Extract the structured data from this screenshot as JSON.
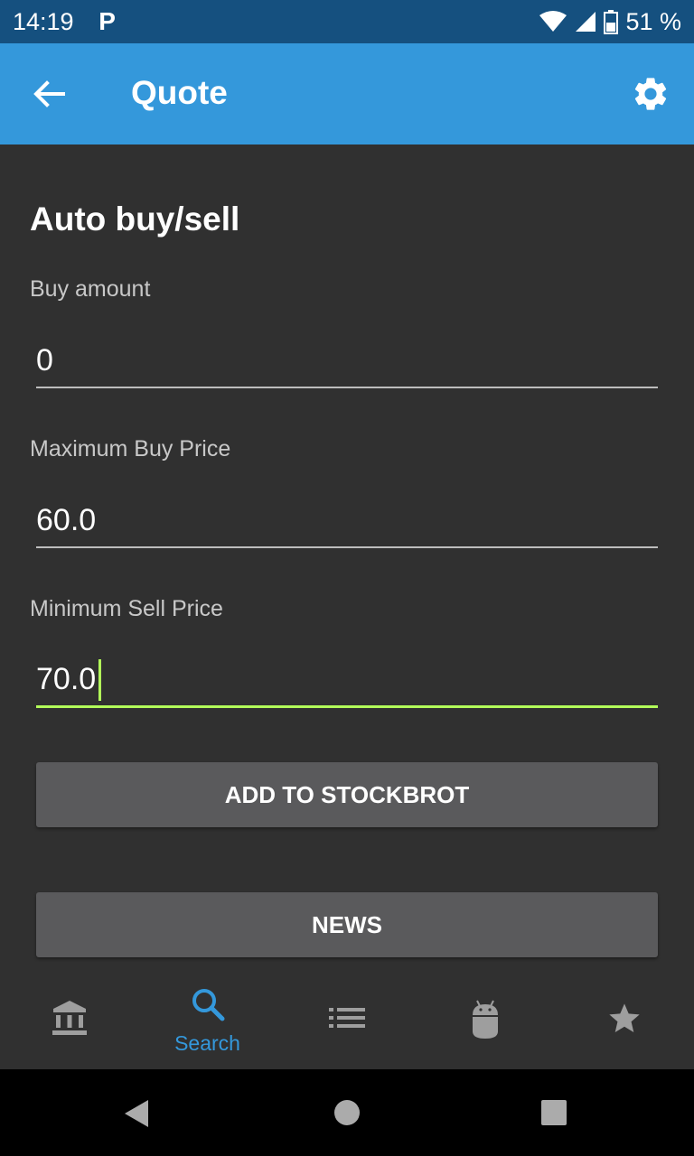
{
  "status_bar": {
    "time": "14:19",
    "notification": "P",
    "battery": "51 %"
  },
  "app_bar": {
    "title": "Quote",
    "back_icon": "arrow-back-icon",
    "settings_icon": "gear-icon"
  },
  "form": {
    "title": "Auto buy/sell",
    "buy_amount": {
      "label": "Buy amount",
      "value": "0"
    },
    "max_buy_price": {
      "label": "Maximum Buy Price",
      "value": "60.0"
    },
    "min_sell_price": {
      "label": "Minimum Sell Price",
      "value": "70.0"
    },
    "add_button": "ADD TO STOCKBROT",
    "news_button": "NEWS"
  },
  "bottom_nav": {
    "items": [
      {
        "icon": "bank-icon"
      },
      {
        "icon": "search-icon",
        "label": "Search",
        "selected": true
      },
      {
        "icon": "list-icon"
      },
      {
        "icon": "android-icon"
      },
      {
        "icon": "star-icon"
      }
    ],
    "active_color": "#3498db",
    "inactive_color": "#9e9e9e"
  },
  "colors": {
    "app_bar": "#3498db",
    "status_bar": "#15507f",
    "background": "#303030",
    "focus_accent": "#b2ff59"
  }
}
